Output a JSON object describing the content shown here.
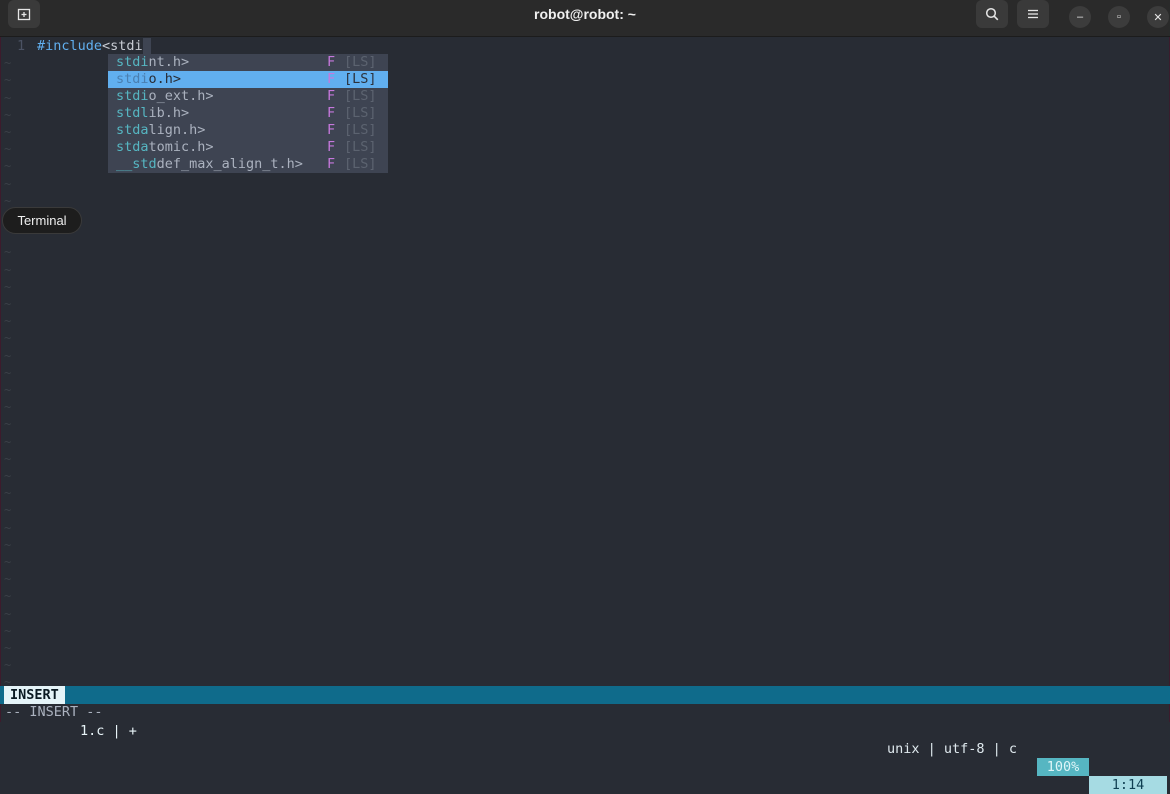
{
  "window": {
    "title": "robot@robot: ~",
    "new_tab_icon": "new-tab-icon",
    "search_icon": "search-icon",
    "menu_icon": "hamburger-menu-icon",
    "minimize_glyph": "–",
    "maximize_glyph": "▫",
    "close_glyph": "✕"
  },
  "editor": {
    "line_number": "1",
    "code_keyword": "#include",
    "code_text": "<stdi",
    "cursor_char": " "
  },
  "completion": {
    "items": [
      {
        "match": "stdi",
        "rest": "nt.h>",
        "kind": "F",
        "source": "[LS]",
        "selected": false
      },
      {
        "match": "stdi",
        "rest": "o.h>",
        "kind": "F",
        "source": "[LS]",
        "selected": true
      },
      {
        "match": "stdi",
        "rest": "o_ext.h>",
        "kind": "F",
        "source": "[LS]",
        "selected": false
      },
      {
        "match": "stdl",
        "rest": "ib.h>",
        "kind": "F",
        "source": "[LS]",
        "selected": false
      },
      {
        "match": "stda",
        "rest": "lign.h>",
        "kind": "F",
        "source": "[LS]",
        "selected": false
      },
      {
        "match": "stda",
        "rest": "tomic.h>",
        "kind": "F",
        "source": "[LS]",
        "selected": false
      },
      {
        "match": "__std",
        "rest": "def_max_align_t.h>",
        "kind": "F",
        "source": "[LS]",
        "selected": false
      }
    ]
  },
  "tooltip": {
    "text": "Terminal"
  },
  "statusline": {
    "mode": "INSERT",
    "file": "1.c | +",
    "format": "unix | utf-8 | c",
    "percent": "100%",
    "position": "1:14"
  },
  "cmdline": {
    "text": "-- INSERT --"
  }
}
